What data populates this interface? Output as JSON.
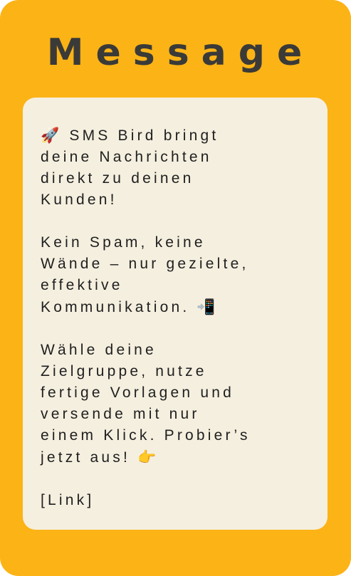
{
  "card": {
    "title": "Message"
  },
  "message": {
    "paragraphs": [
      {
        "emoji_before": "🚀",
        "text": " SMS Bird bringt\ndeine Nachrichten\ndirekt zu deinen\nKunden!",
        "emoji_after": ""
      },
      {
        "emoji_before": "",
        "text": "Kein Spam, keine\nWände – nur gezielte,\neffektive\nKommunikation. ",
        "emoji_after": "📲"
      },
      {
        "emoji_before": "",
        "text": "Wähle deine\nZielgruppe, nutze\nfertige Vorlagen und\nversende mit nur\neinem Klick. Probier’s\njetzt aus! ",
        "emoji_after": "👉"
      },
      {
        "emoji_before": "",
        "text": "[Link]",
        "emoji_after": ""
      }
    ]
  },
  "colors": {
    "card_background": "#fbb316",
    "message_background": "#f5efdf",
    "title_text": "#3a3a38",
    "body_text": "#1f1f1f"
  }
}
